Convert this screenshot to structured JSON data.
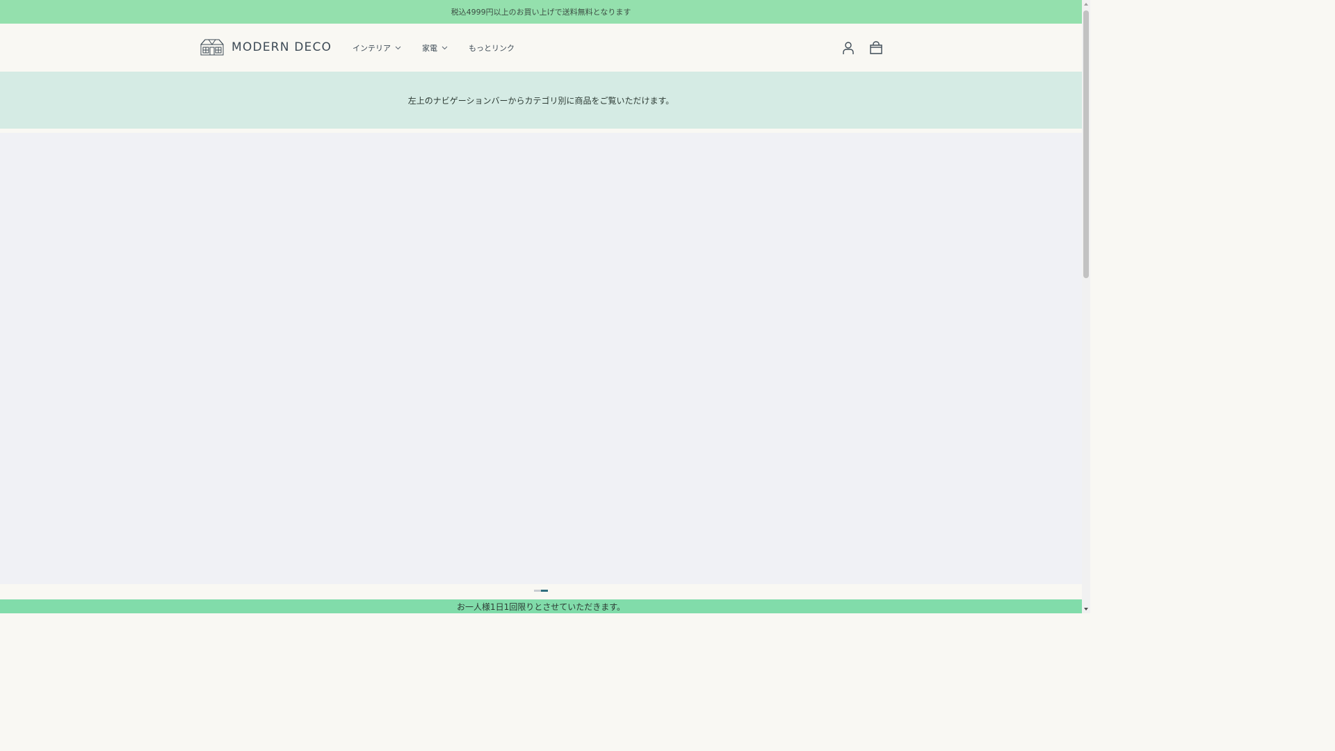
{
  "announcement": {
    "text": "税込4999円以上のお買い上げで送料無料となります"
  },
  "header": {
    "logo_text": "MODERN DECO",
    "nav": [
      {
        "label": "インテリア",
        "has_dropdown": true
      },
      {
        "label": "家電",
        "has_dropdown": true
      },
      {
        "label": "もっとリンク",
        "has_dropdown": false
      }
    ],
    "icons": [
      "account-icon",
      "cart-icon"
    ]
  },
  "info_banner": {
    "text": "左上のナビゲーションバーからカテゴリ別に商品をご覧いただけます。"
  },
  "slideshow": {
    "slide_count": 2,
    "active_index": 1
  },
  "bottom_bar": {
    "text": "お一人様1日1回限りとさせていただきます。"
  },
  "colors": {
    "announcement_bg": "#94e0ad",
    "info_banner_bg": "#d5ebe4",
    "hero_bg": "#f0f1f5",
    "bottom_bar_bg": "#81dcaa",
    "dot_inactive": "#c9cdd2",
    "dot_active": "#2e6e7e"
  }
}
